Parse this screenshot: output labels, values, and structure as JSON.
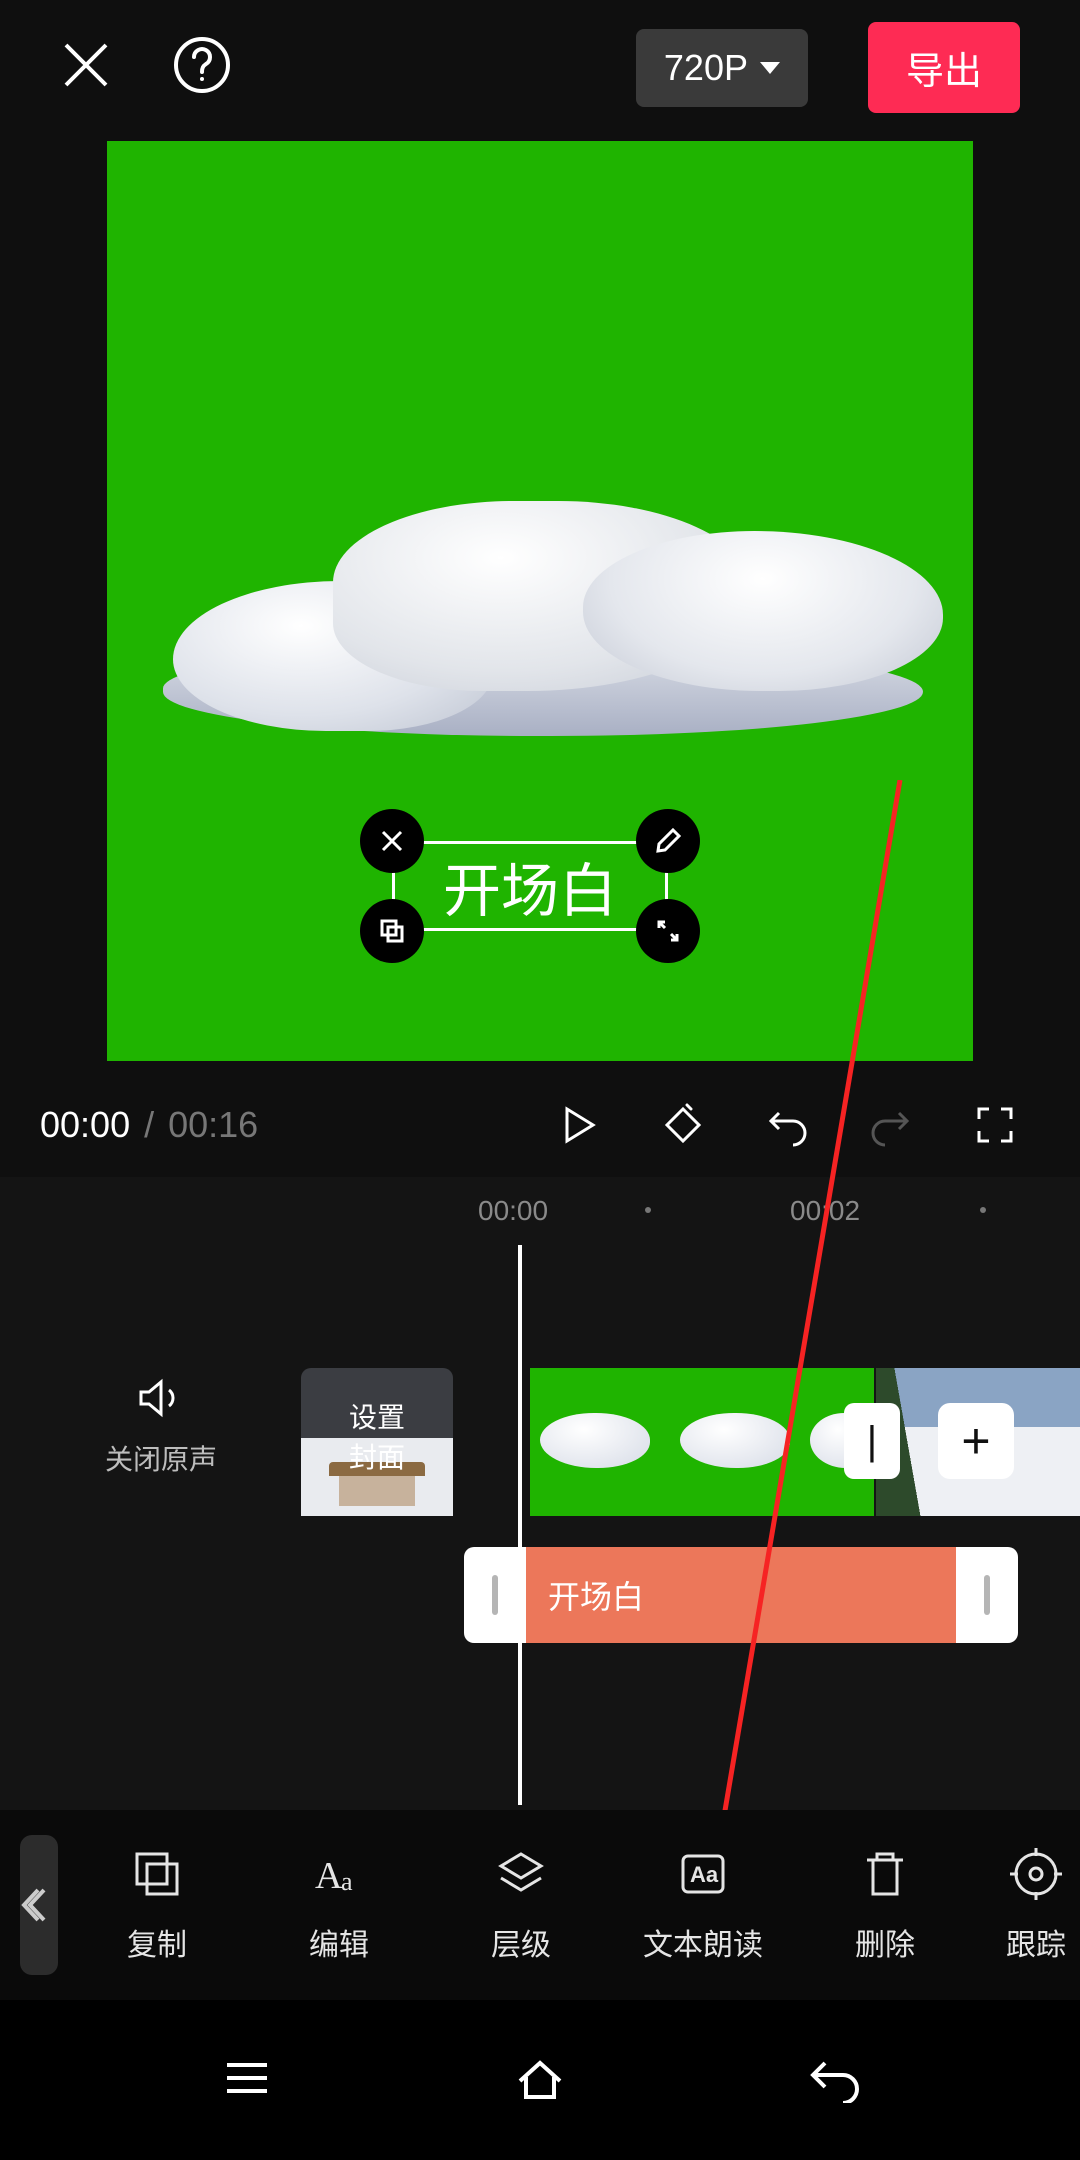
{
  "header": {
    "resolution": "720P",
    "export": "导出"
  },
  "preview": {
    "text_overlay": "开场白"
  },
  "playback": {
    "current": "00:00",
    "sep": " / ",
    "total": "00:16"
  },
  "ruler": {
    "t0": "00:00",
    "t1": "00:02"
  },
  "timeline": {
    "mute_label": "关闭原声",
    "cover_l1": "设置",
    "cover_l2": "封面",
    "text_clip": "开场白",
    "sep": "|",
    "add": "+"
  },
  "toolbar": {
    "copy": "复制",
    "edit": "编辑",
    "layer": "层级",
    "tts": "文本朗读",
    "delete": "删除",
    "track": "跟踪"
  }
}
